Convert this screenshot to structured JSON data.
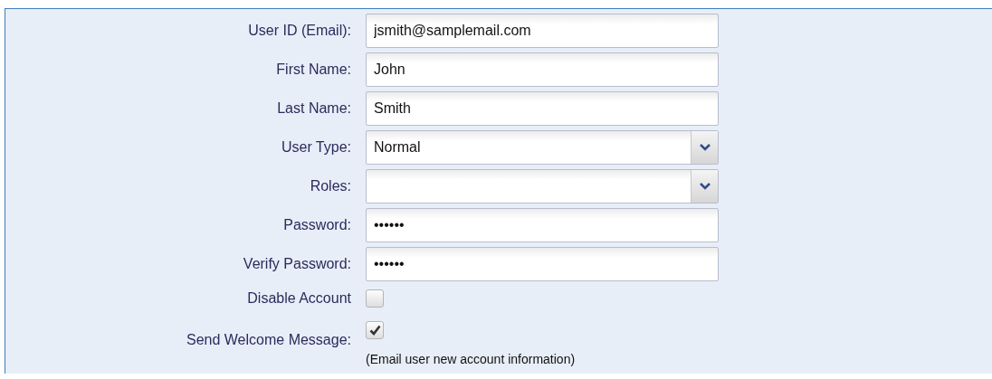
{
  "form": {
    "fields": [
      {
        "kind": "text",
        "label": "User ID (Email):",
        "value": "jsmith@samplemail.com"
      },
      {
        "kind": "text",
        "label": "First Name:",
        "value": "John"
      },
      {
        "kind": "text",
        "label": "Last Name:",
        "value": "Smith"
      },
      {
        "kind": "select",
        "label": "User Type:",
        "value": "Normal"
      },
      {
        "kind": "select",
        "label": "Roles:"
      },
      {
        "kind": "text",
        "label": "Password:",
        "value": "••••••"
      },
      {
        "kind": "text",
        "label": "Verify Password:",
        "value": "••••••"
      },
      {
        "kind": "checkbox",
        "label": "Disable Account",
        "checked": false
      },
      {
        "kind": "checkbox",
        "label": "Send Welcome Message:",
        "checked": true,
        "note": "(Email user new account information)"
      }
    ]
  }
}
